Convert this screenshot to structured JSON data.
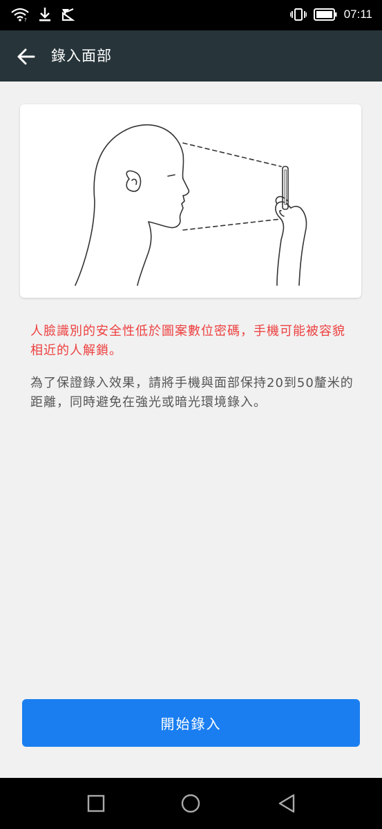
{
  "status_bar": {
    "time": "07:11",
    "icons_left": [
      "wifi-icon",
      "download-icon",
      "notification-icon"
    ],
    "icons_right": [
      "vibrate-icon",
      "battery-icon"
    ]
  },
  "app_bar": {
    "title": "錄入面部",
    "back_icon": "arrow-back-icon"
  },
  "illustration": {
    "description_icon": "face-scan-illustration"
  },
  "warning": "人臉識別的安全性低於圖案數位密碼，手機可能被容貌相近的人解鎖。",
  "info": "為了保證錄入效果，請將手機與面部保持20到50釐米的距離，同時避免在強光或暗光環境錄入。",
  "start_button": "開始錄入",
  "colors": {
    "app_bar": "#27353a",
    "warning": "#ee3f3f",
    "button": "#1a7ef1",
    "background": "#f1f1f1"
  },
  "nav_bar": {
    "icons": [
      "recents-icon",
      "home-icon",
      "back-icon"
    ]
  }
}
